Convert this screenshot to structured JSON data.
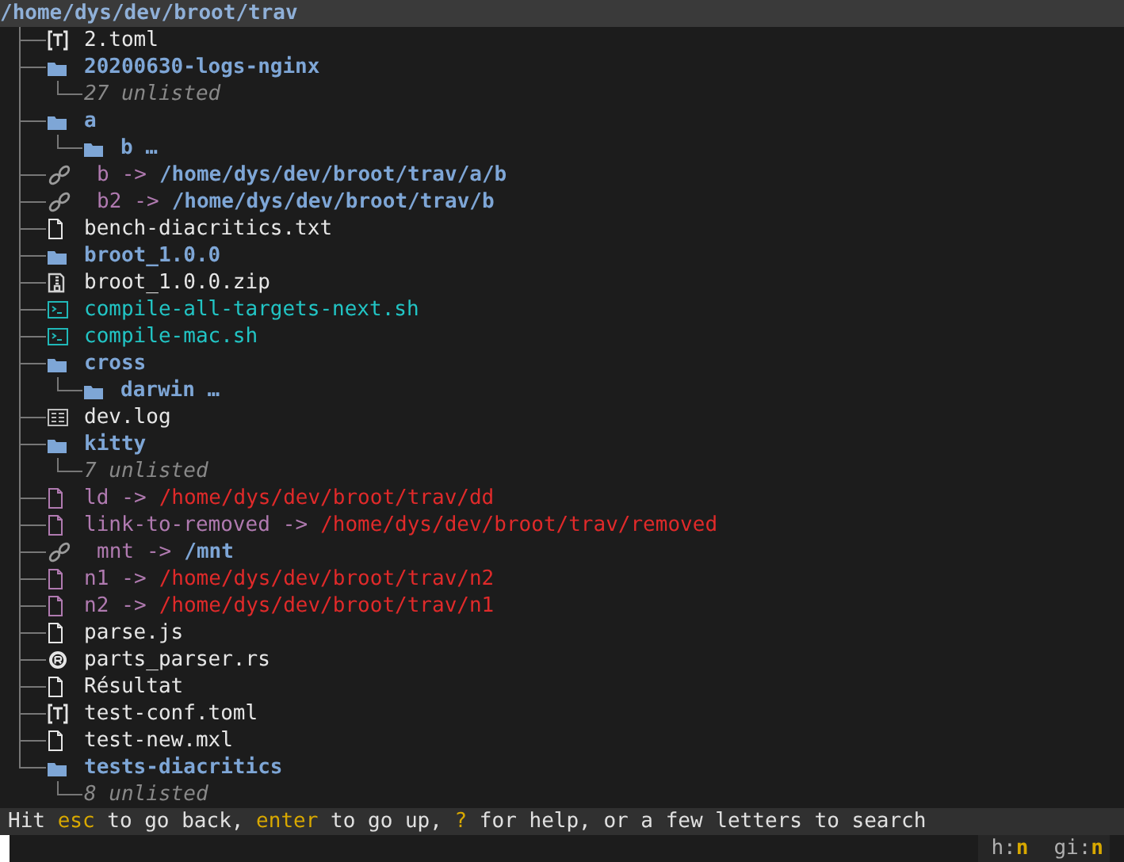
{
  "header": {
    "path": "/home/dys/dev/broot/trav"
  },
  "tree": [
    {
      "kind": "toml",
      "name": "2.toml"
    },
    {
      "kind": "dir",
      "name": "20200630-logs-nginx",
      "children": [
        {
          "kind": "unlisted",
          "text": "27 unlisted"
        }
      ]
    },
    {
      "kind": "dir",
      "name": "a",
      "children": [
        {
          "kind": "dir",
          "name": "b …"
        }
      ]
    },
    {
      "kind": "link",
      "name": "b",
      "arrow": "->",
      "target": "/home/dys/dev/broot/trav/a/b"
    },
    {
      "kind": "link",
      "name": "b2",
      "arrow": "->",
      "target": "/home/dys/dev/broot/trav/b"
    },
    {
      "kind": "file",
      "name": "bench-diacritics.txt"
    },
    {
      "kind": "dir",
      "name": "broot_1.0.0"
    },
    {
      "kind": "archive",
      "name": "broot_1.0.0.zip"
    },
    {
      "kind": "script",
      "name": "compile-all-targets-next.sh"
    },
    {
      "kind": "script",
      "name": "compile-mac.sh"
    },
    {
      "kind": "dir",
      "name": "cross",
      "children": [
        {
          "kind": "dir",
          "name": "darwin …"
        }
      ]
    },
    {
      "kind": "log",
      "name": "dev.log"
    },
    {
      "kind": "dir",
      "name": "kitty",
      "children": [
        {
          "kind": "unlisted",
          "text": "7 unlisted"
        }
      ]
    },
    {
      "kind": "broken",
      "name": "ld",
      "arrow": "->",
      "target": "/home/dys/dev/broot/trav/dd"
    },
    {
      "kind": "broken",
      "name": "link-to-removed",
      "arrow": "->",
      "target": "/home/dys/dev/broot/trav/removed"
    },
    {
      "kind": "link",
      "name": "mnt",
      "arrow": "->",
      "target": "/mnt"
    },
    {
      "kind": "broken",
      "name": "n1",
      "arrow": "->",
      "target": "/home/dys/dev/broot/trav/n2"
    },
    {
      "kind": "broken",
      "name": "n2",
      "arrow": "->",
      "target": "/home/dys/dev/broot/trav/n1"
    },
    {
      "kind": "file",
      "name": "parse.js"
    },
    {
      "kind": "rust",
      "name": "parts_parser.rs"
    },
    {
      "kind": "file",
      "name": "Résultat"
    },
    {
      "kind": "toml",
      "name": "test-conf.toml"
    },
    {
      "kind": "file",
      "name": "test-new.mxl"
    },
    {
      "kind": "dir",
      "name": "tests-diacritics",
      "children": [
        {
          "kind": "unlisted",
          "text": "8 unlisted"
        }
      ]
    }
  ],
  "status": [
    {
      "text": "Hit ",
      "key": false
    },
    {
      "text": "esc",
      "key": true
    },
    {
      "text": " to go back, ",
      "key": false
    },
    {
      "text": "enter",
      "key": true
    },
    {
      "text": " to go up, ",
      "key": false
    },
    {
      "text": "?",
      "key": true
    },
    {
      "text": " for help, or a few letters to search",
      "key": false
    }
  ],
  "flags": [
    {
      "name": "h:",
      "value": "n"
    },
    {
      "name": "gi:",
      "value": "n"
    }
  ]
}
